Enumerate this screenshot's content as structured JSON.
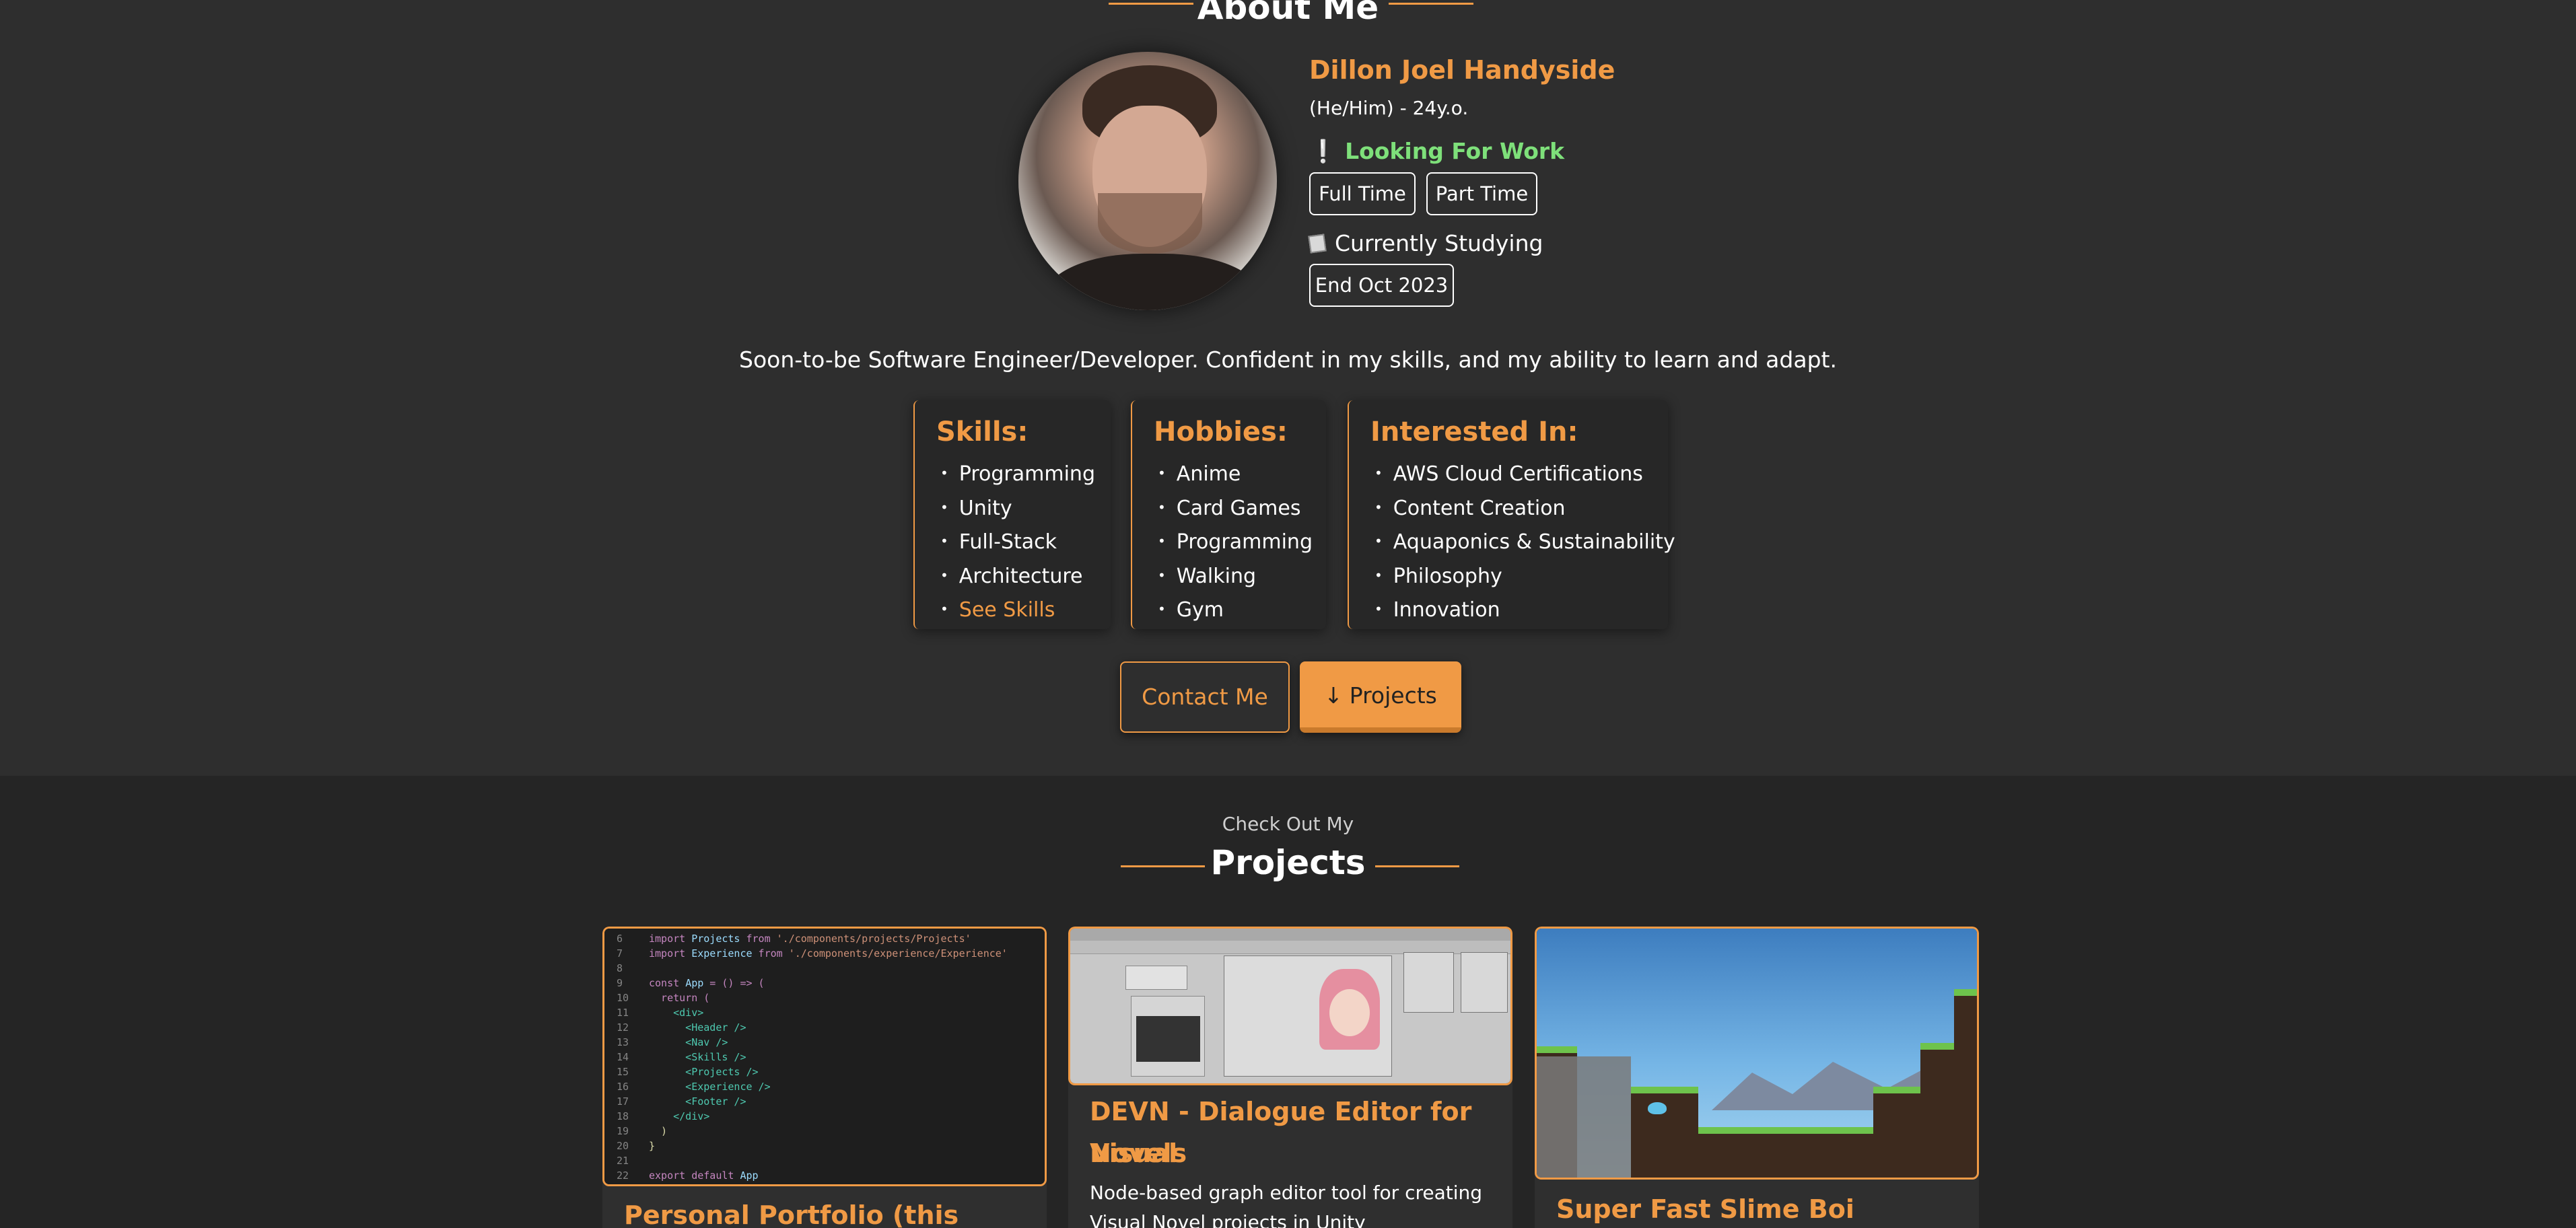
{
  "about": {
    "heading": "About Me",
    "name": "Dillon Joel Handyside",
    "pronouns": "(He/Him) - 24y.o.",
    "looking_for_work": "Looking For Work",
    "work_types": [
      "Full Time",
      "Part Time"
    ],
    "studying": "Currently Studying",
    "study_end": "End Oct 2023",
    "tagline": "Soon-to-be Software Engineer/Developer. Confident in my skills, and my ability to learn and adapt."
  },
  "cards": {
    "skills": {
      "title": "Skills:",
      "items": [
        "Programming",
        "Unity",
        "Full-Stack",
        "Architecture"
      ],
      "link": "See Skills"
    },
    "hobbies": {
      "title": "Hobbies:",
      "items": [
        "Anime",
        "Card Games",
        "Programming",
        "Walking",
        "Gym"
      ]
    },
    "interests": {
      "title": "Interested In:",
      "items": [
        "AWS Cloud Certifications",
        "Content Creation",
        "Aquaponics & Sustainability",
        "Philosophy",
        "Innovation"
      ]
    }
  },
  "buttons": {
    "contact": "Contact Me",
    "projects": "Projects"
  },
  "projects": {
    "eyebrow": "Check Out My",
    "heading": "Projects",
    "items": [
      {
        "title": "Personal Portfolio (this website!)"
      },
      {
        "title_line1": "DEVN - Dialogue Editor for Visual",
        "title_line2": "Novels",
        "desc_line1": "Node-based graph editor tool for creating",
        "desc_line2": "Visual Novel projects in Unity"
      },
      {
        "title": "Super Fast Slime Boi"
      }
    ]
  },
  "code_lines": [
    {
      "n": "6",
      "a": "import ",
      "b": "Projects",
      "c": " from ",
      "d": "'./components/projects/Projects'"
    },
    {
      "n": "7",
      "a": "import ",
      "b": "Experience",
      "c": " from ",
      "d": "'./components/experience/Experience'"
    },
    {
      "n": "8"
    },
    {
      "n": "9",
      "a": "const ",
      "b": "App",
      "c": " = () => ("
    },
    {
      "n": "10",
      "a": "  return ("
    },
    {
      "n": "11",
      "t": "    <div>"
    },
    {
      "n": "12",
      "t": "      <Header />"
    },
    {
      "n": "13",
      "t": "      <Nav />"
    },
    {
      "n": "14",
      "t": "      <Skills />"
    },
    {
      "n": "15",
      "t": "      <Projects />"
    },
    {
      "n": "16",
      "t": "      <Experience />"
    },
    {
      "n": "17",
      "t": "      <Footer />"
    },
    {
      "n": "18",
      "t": "    </div>"
    },
    {
      "n": "19",
      "p": "  )"
    },
    {
      "n": "20",
      "p": "}"
    },
    {
      "n": "21"
    },
    {
      "n": "22",
      "a": "export default ",
      "b": "App"
    }
  ],
  "colors": {
    "accent": "#f09a45",
    "status_green": "#7ee07a",
    "bg_about": "#2e2e2e",
    "bg_projects": "#252525"
  }
}
